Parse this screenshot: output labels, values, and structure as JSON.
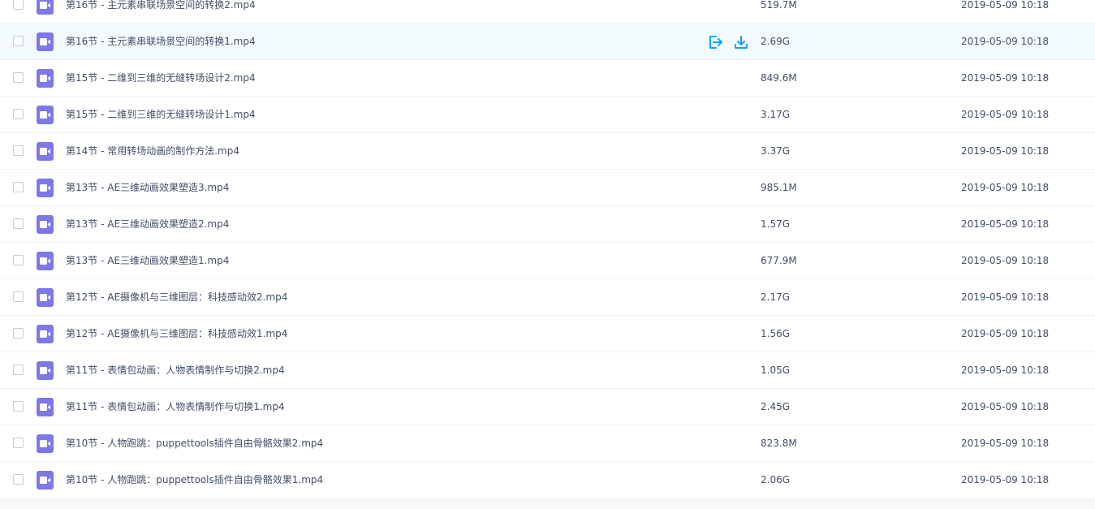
{
  "files": [
    {
      "name": "第16节 - 主元素串联场景空间的转换2.mp4",
      "size": "519.7M",
      "date": "2019-05-09 10:18"
    },
    {
      "name": "第16节 - 主元素串联场景空间的转换1.mp4",
      "size": "2.69G",
      "date": "2019-05-09 10:18"
    },
    {
      "name": "第15节 - 二维到三维的无缝转场设计2.mp4",
      "size": "849.6M",
      "date": "2019-05-09 10:18"
    },
    {
      "name": "第15节 - 二维到三维的无缝转场设计1.mp4",
      "size": "3.17G",
      "date": "2019-05-09 10:18"
    },
    {
      "name": "第14节 - 常用转场动画的制作方法.mp4",
      "size": "3.37G",
      "date": "2019-05-09 10:18"
    },
    {
      "name": "第13节 - AE三维动画效果塑造3.mp4",
      "size": "985.1M",
      "date": "2019-05-09 10:18"
    },
    {
      "name": "第13节 - AE三维动画效果塑造2.mp4",
      "size": "1.57G",
      "date": "2019-05-09 10:18"
    },
    {
      "name": "第13节 - AE三维动画效果塑造1.mp4",
      "size": "677.9M",
      "date": "2019-05-09 10:18"
    },
    {
      "name": "第12节 - AE摄像机与三维图层：科技感动效2.mp4",
      "size": "2.17G",
      "date": "2019-05-09 10:18"
    },
    {
      "name": "第12节 - AE摄像机与三维图层：科技感动效1.mp4",
      "size": "1.56G",
      "date": "2019-05-09 10:18"
    },
    {
      "name": "第11节 - 表情包动画：人物表情制作与切换2.mp4",
      "size": "1.05G",
      "date": "2019-05-09 10:18"
    },
    {
      "name": "第11节 - 表情包动画：人物表情制作与切换1.mp4",
      "size": "2.45G",
      "date": "2019-05-09 10:18"
    },
    {
      "name": "第10节 - 人物跑跳：puppettools插件自由骨骼效果2.mp4",
      "size": "823.8M",
      "date": "2019-05-09 10:18"
    },
    {
      "name": "第10节 - 人物跑跳：puppettools插件自由骨骼效果1.mp4",
      "size": "2.06G",
      "date": "2019-05-09 10:18"
    }
  ],
  "hovered_row": 1,
  "icons": {
    "file_type": "video-file-icon",
    "share": "share-icon",
    "download": "download-icon"
  },
  "colors": {
    "accent": "#06a7ff",
    "file_icon": "#7c78e8",
    "hover_bg": "#f4fbff",
    "text": "#424e67"
  }
}
